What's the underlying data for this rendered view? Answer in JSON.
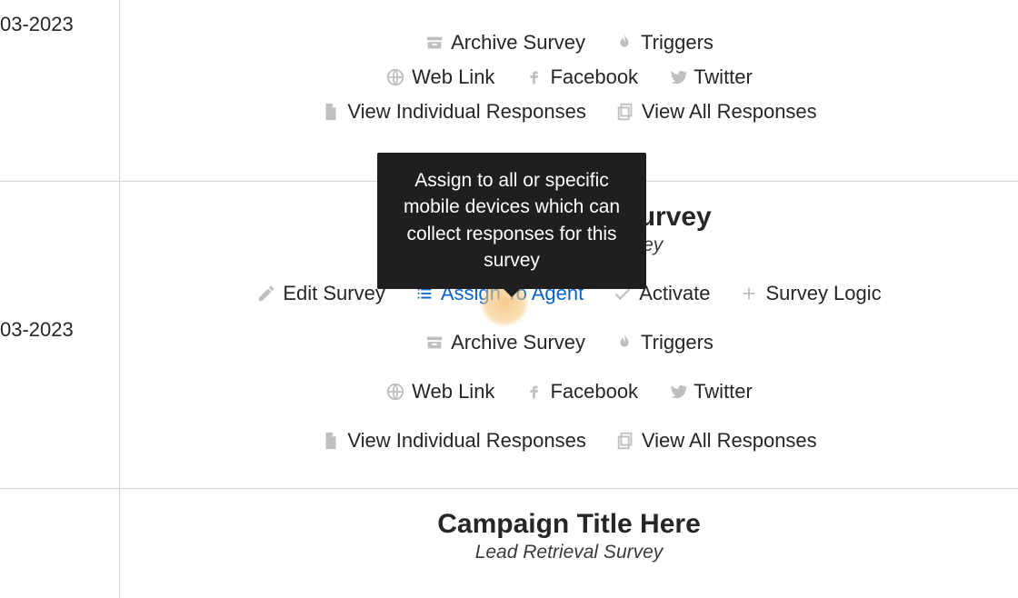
{
  "tooltip": "Assign to all or specific mobile devices which can collect responses for this survey",
  "rows": [
    {
      "date": "03-2023",
      "title": "",
      "subtitle": "",
      "actions": {
        "archive": "Archive Survey",
        "triggers": "Triggers",
        "weblink": "Web Link",
        "facebook": "Facebook",
        "twitter": "Twitter",
        "view_individual": "View Individual Responses",
        "view_all": "View All Responses"
      }
    },
    {
      "date": "03-2023",
      "title": "Lead Retrieval Survey",
      "subtitle": "Lead Retrieval Survey",
      "actions": {
        "edit": "Edit Survey",
        "assign": "Assign To Agent",
        "activate": "Activate",
        "logic": "Survey Logic",
        "archive": "Archive Survey",
        "triggers": "Triggers",
        "weblink": "Web Link",
        "facebook": "Facebook",
        "twitter": "Twitter",
        "view_individual": "View Individual Responses",
        "view_all": "View All Responses"
      }
    },
    {
      "date": "",
      "title": "Campaign Title Here",
      "subtitle": "Lead Retrieval Survey"
    }
  ]
}
